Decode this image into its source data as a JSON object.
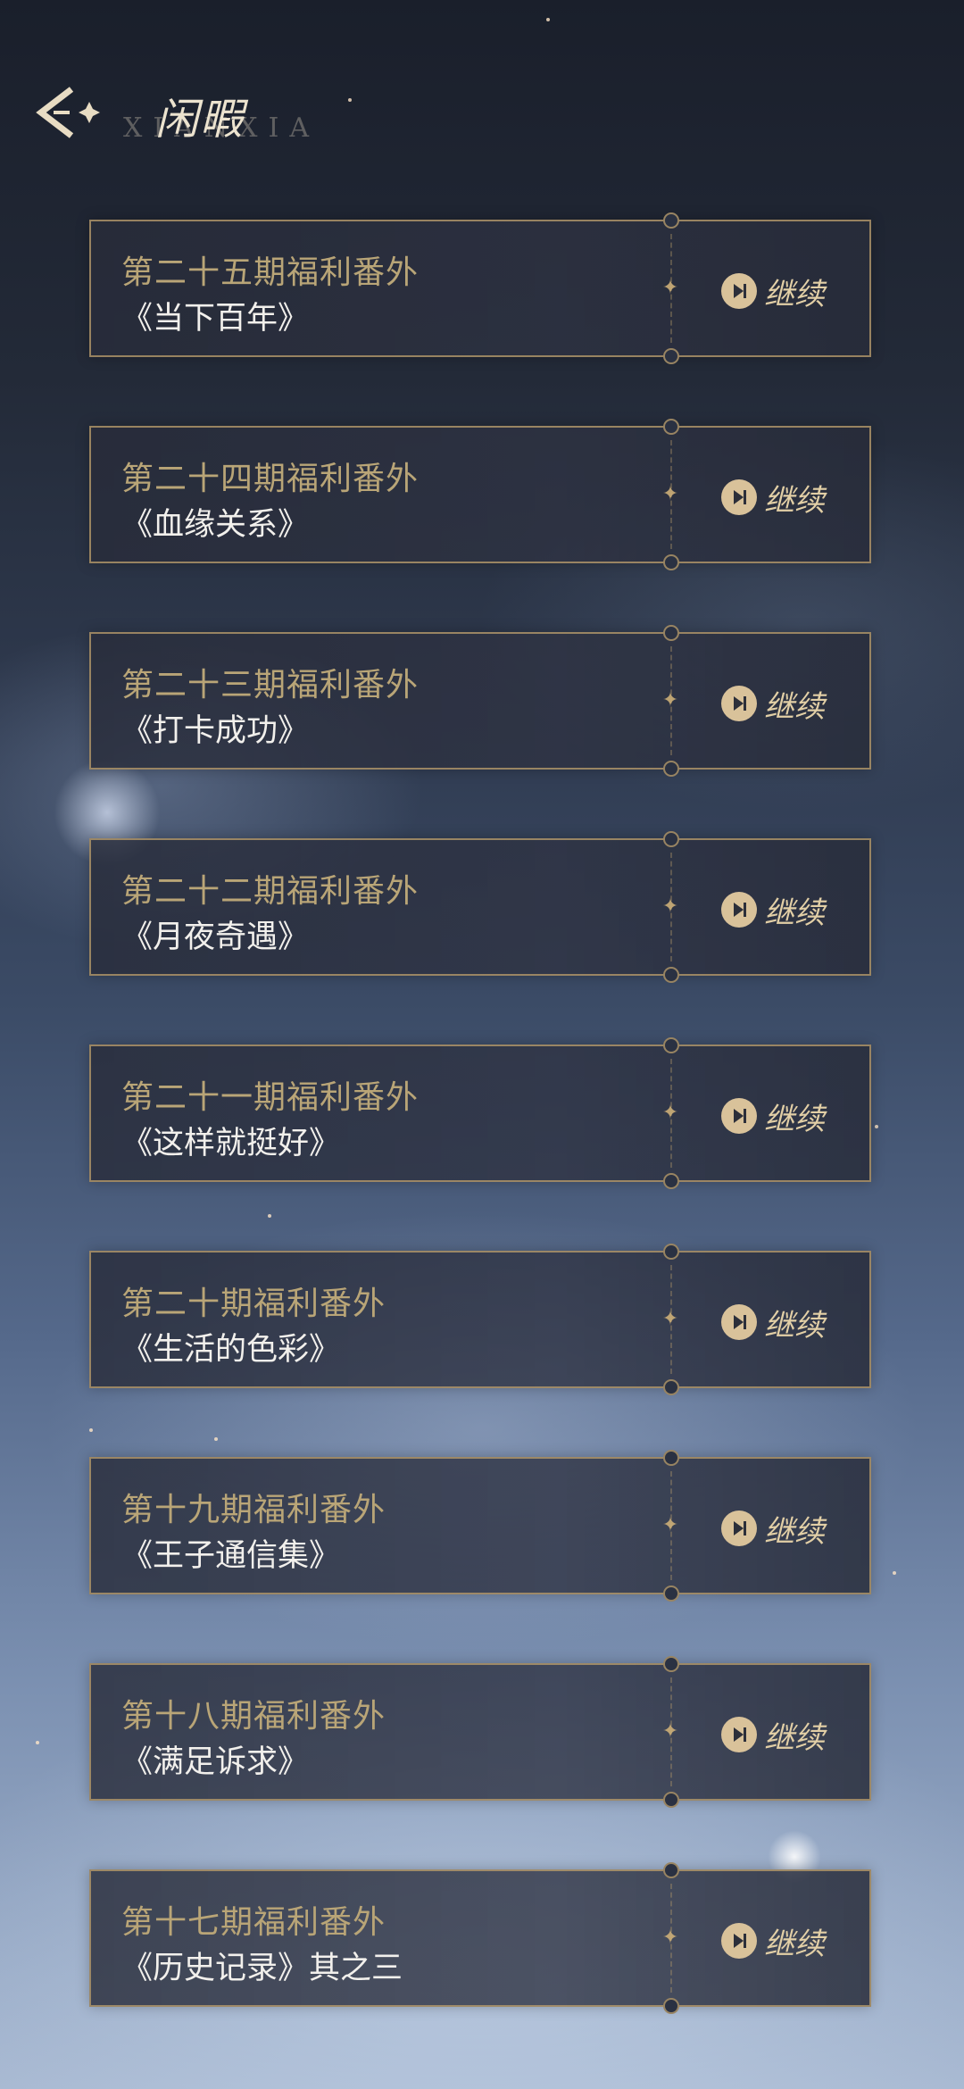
{
  "header": {
    "title": "闲暇",
    "subtitle": "XIANXIA"
  },
  "colors": {
    "accent_gold": "#b9a577",
    "border_gold": "#bea06e",
    "text_light": "#f2f0ec"
  },
  "icons": {
    "back": "back-arrow-icon",
    "play": "play-icon",
    "sparkle": "sparkle-icon"
  },
  "items": [
    {
      "episode": "第二十五期福利番外",
      "name": "《当下百年》",
      "action": "继续"
    },
    {
      "episode": "第二十四期福利番外",
      "name": "《血缘关系》",
      "action": "继续"
    },
    {
      "episode": "第二十三期福利番外",
      "name": "《打卡成功》",
      "action": "继续"
    },
    {
      "episode": "第二十二期福利番外",
      "name": "《月夜奇遇》",
      "action": "继续"
    },
    {
      "episode": "第二十一期福利番外",
      "name": "《这样就挺好》",
      "action": "继续"
    },
    {
      "episode": "第二十期福利番外",
      "name": "《生活的色彩》",
      "action": "继续"
    },
    {
      "episode": "第十九期福利番外",
      "name": "《王子通信集》",
      "action": "继续"
    },
    {
      "episode": "第十八期福利番外",
      "name": "《满足诉求》",
      "action": "继续"
    },
    {
      "episode": "第十七期福利番外",
      "name": "《历史记录》其之三",
      "action": "继续"
    }
  ]
}
